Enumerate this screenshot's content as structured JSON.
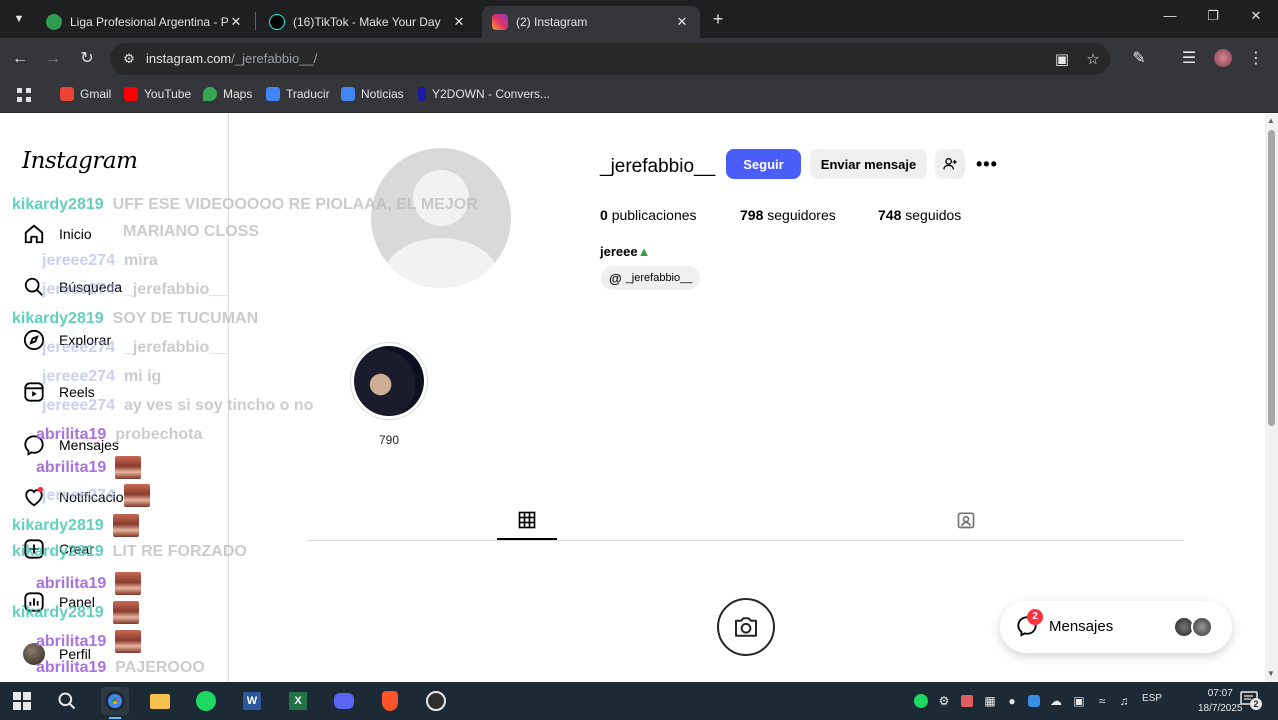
{
  "browser": {
    "tabs": [
      {
        "title": "Liga Profesional Argentina - PO",
        "favicon_color": "#2e9b4f"
      },
      {
        "title": "(16)TikTok - Make Your Day",
        "favicon_color": "#000000"
      },
      {
        "title": "(2) Instagram",
        "favicon_color": "#e1306c",
        "active": true
      }
    ],
    "url_domain": "instagram.com",
    "url_path": "/_jerefabbio__/",
    "bookmarks": [
      {
        "label": "Gmail",
        "color": "#ea4335"
      },
      {
        "label": "YouTube",
        "color": "#ff0000"
      },
      {
        "label": "Maps",
        "color": "#34a853"
      },
      {
        "label": "Traducir",
        "color": "#4285f4"
      },
      {
        "label": "Noticias",
        "color": "#4285f4"
      },
      {
        "label": "Y2DOWN - Convers...",
        "color": "#1a1aa6"
      }
    ]
  },
  "instagram": {
    "logo": "Instagram",
    "nav": [
      {
        "label": "Inicio",
        "icon": "home-icon"
      },
      {
        "label": "Búsqueda",
        "icon": "search-icon"
      },
      {
        "label": "Explorar",
        "icon": "compass-icon"
      },
      {
        "label": "Reels",
        "icon": "reels-icon"
      },
      {
        "label": "Mensajes",
        "icon": "messenger-icon"
      },
      {
        "label": "Notificaciones",
        "icon": "heart-icon"
      },
      {
        "label": "Crear",
        "icon": "plus-icon"
      },
      {
        "label": "Panel",
        "icon": "chart-icon"
      },
      {
        "label": "Perfil",
        "icon": "avatar"
      }
    ],
    "profile": {
      "username": "_jerefabbio__",
      "follow_label": "Seguir",
      "message_label": "Enviar mensaje",
      "posts_count": "0",
      "posts_label": "publicaciones",
      "followers_count": "798",
      "followers_label": "seguidores",
      "following_count": "748",
      "following_label": "seguidos",
      "full_name": "jereee",
      "threads_handle": "_jerefabbio__",
      "highlight_label": "790"
    },
    "messages_widget": {
      "label": "Mensajes",
      "badge": "2"
    }
  },
  "chat_overlay": [
    {
      "user": "kikardy2819",
      "msg": "UFF ESE VIDEOOOOO RE PIOLAAA, EL MEJOR",
      "color": "teal"
    },
    {
      "user": "",
      "msg": "MARIANO CLOSS",
      "color": "teal"
    },
    {
      "user": "jereee274",
      "msg": "mira",
      "color": "ghost"
    },
    {
      "user": "jereee274",
      "msg": "_jerefabbio__",
      "color": "ghost"
    },
    {
      "user": "kikardy2819",
      "msg": "SOY DE TUCUMAN",
      "color": "teal"
    },
    {
      "user": "jereee274",
      "msg": "_jerefabbio__",
      "color": "ghost"
    },
    {
      "user": "jereee274",
      "msg": "mi ig",
      "color": "ghost"
    },
    {
      "user": "jereee274",
      "msg": "ay ves si soy tincho o no",
      "color": "ghost"
    },
    {
      "user": "abrilita19",
      "msg": "probechota",
      "color": "purple"
    },
    {
      "user": "abrilita19",
      "msg": "",
      "color": "purple",
      "emote": true
    },
    {
      "user": "jereee274",
      "msg": "",
      "color": "ghost",
      "emote": true
    },
    {
      "user": "kikardy2819",
      "msg": "",
      "color": "teal",
      "emote": true
    },
    {
      "user": "kikardy2819",
      "msg": "LIT RE FORZADO",
      "color": "teal"
    },
    {
      "user": "abrilita19",
      "msg": "",
      "color": "purple",
      "emote": true
    },
    {
      "user": "kikardy2819",
      "msg": "",
      "color": "teal",
      "emote": true
    },
    {
      "user": "abrilita19",
      "msg": "",
      "color": "purple",
      "emote": true
    },
    {
      "user": "abrilita19",
      "msg": "PAJEROOO",
      "color": "purple"
    }
  ],
  "taskbar": {
    "language": "ESP",
    "time": "07:07",
    "date": "18/7/2025",
    "notifications": "2"
  }
}
